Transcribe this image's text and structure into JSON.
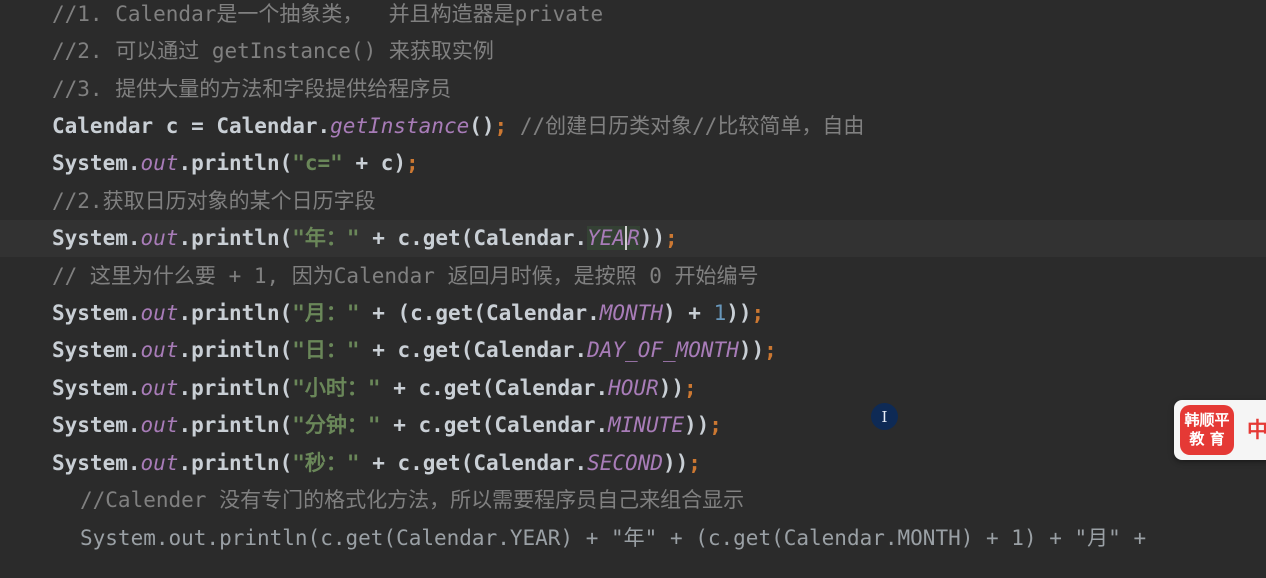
{
  "editor": {
    "lines": [
      {
        "kind": "comment",
        "text": "//1. Calendar是一个抽象类，  并且构造器是private"
      },
      {
        "kind": "comment",
        "text": "//2. 可以通过 getInstance() 来获取实例"
      },
      {
        "kind": "comment",
        "text": "//3. 提供大量的方法和字段提供给程序员"
      },
      {
        "kind": "code",
        "parts": [
          "Calendar c = Calendar.",
          "getInstance",
          "()",
          ";",
          " //创建日历类对象//比较简单，自由"
        ]
      },
      {
        "kind": "code",
        "parts": [
          "System.",
          "out",
          ".println(",
          "\"c=\"",
          " + c)",
          ";"
        ]
      },
      {
        "kind": "comment",
        "text": "//2.获取日历对象的某个日历字段"
      },
      {
        "kind": "code",
        "parts": [
          "System.",
          "out",
          ".println(",
          "\"年：\"",
          " + c.get(Calendar.",
          "YEA",
          "R",
          "))",
          ";"
        ]
      },
      {
        "kind": "comment",
        "text": "// 这里为什么要 + 1, 因为Calendar 返回月时候，是按照 0 开始编号"
      },
      {
        "kind": "code",
        "parts": [
          "System.",
          "out",
          ".println(",
          "\"月：\"",
          " + (c.get(Calendar.",
          "MONTH",
          ") + ",
          "1",
          "))",
          ";"
        ]
      },
      {
        "kind": "code",
        "parts": [
          "System.",
          "out",
          ".println(",
          "\"日：\"",
          " + c.get(Calendar.",
          "DAY_OF_MONTH",
          "))",
          ";"
        ]
      },
      {
        "kind": "code",
        "parts": [
          "System.",
          "out",
          ".println(",
          "\"小时：\"",
          " + c.get(Calendar.",
          "HOUR",
          "))",
          ";"
        ]
      },
      {
        "kind": "code",
        "parts": [
          "System.",
          "out",
          ".println(",
          "\"分钟：\"",
          " + c.get(Calendar.",
          "MINUTE",
          "))",
          ";"
        ]
      },
      {
        "kind": "code",
        "parts": [
          "System.",
          "out",
          ".println(",
          "\"秒：\"",
          " + c.get(Calendar.",
          "SECOND",
          "))",
          ";"
        ]
      },
      {
        "kind": "comment",
        "text": "//Calender 没有专门的格式化方法，所以需要程序员自己来组合显示"
      },
      {
        "kind": "code",
        "text": "System.out.println(c.get(Calendar.YEAR) + \"年\" + (c.get(Calendar.MONTH) + 1) + \"月\" +"
      }
    ]
  },
  "cursor_indicator": {
    "glyph": "I"
  },
  "badge": {
    "logo_line1": "韩顺平",
    "logo_line2": "教 育",
    "text": "中"
  },
  "colors": {
    "background": "#2b2b2b",
    "comment": "#808080",
    "string": "#6a8759",
    "static_field": "#a87cb8",
    "semicolon": "#cc7832",
    "number": "#6897bb",
    "badge_red": "#e53935"
  }
}
